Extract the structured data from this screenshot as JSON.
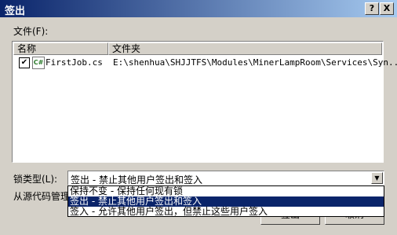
{
  "window": {
    "title": "签出",
    "help_button": "?",
    "close_button": "X"
  },
  "files_label": "文件(F):",
  "list": {
    "columns": [
      "名称",
      "文件夹"
    ],
    "rows": [
      {
        "checked": true,
        "icon": "csharp-file-icon",
        "name": "FirstJob.cs",
        "folder": "E:\\shenhua\\SHJJTFS\\Modules\\MinerLampRoom\\Services\\Syn..."
      }
    ]
  },
  "lock_type_label": "锁类型(L):",
  "lock_type_value": "签出 - 禁止其他用户签出和签入",
  "dropdown_options": [
    "保持不变 - 保持任何现有锁",
    "签出 - 禁止其他用户签出和签入",
    "签入 - 允许其他用户签出，但禁止这些用户签入"
  ],
  "selected_option_index": 1,
  "source_label": "从源代码管理",
  "buttons": {
    "checkout": "签出",
    "cancel": "取消"
  }
}
